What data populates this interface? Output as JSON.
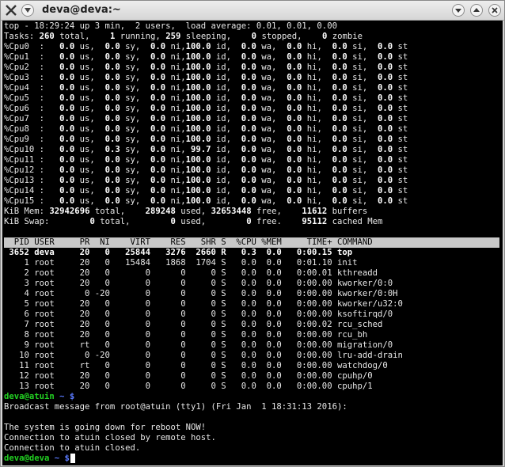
{
  "window": {
    "title": "deva@deva:~"
  },
  "top": {
    "summary": "top - 18:29:24 up 3 min,  2 users,  load average: 0.01, 0.01, 0.00",
    "tasks": {
      "label": "Tasks:",
      "total": "260",
      "total_l": "total,",
      "running": "1",
      "running_l": "running,",
      "sleeping": "259",
      "sleeping_l": "sleeping,",
      "stopped": "0",
      "stopped_l": "stopped,",
      "zombie": "0",
      "zombie_l": "zombie"
    },
    "cpu_rows": [
      {
        "label": "%Cpu0  :",
        "us": "0.0",
        "sy": "0.0",
        "ni": "0.0",
        "id": "100.0",
        "wa": "0.0",
        "hi": "0.0",
        "si": "0.0",
        "st": "0.0"
      },
      {
        "label": "%Cpu1  :",
        "us": "0.0",
        "sy": "0.0",
        "ni": "0.0",
        "id": "100.0",
        "wa": "0.0",
        "hi": "0.0",
        "si": "0.0",
        "st": "0.0"
      },
      {
        "label": "%Cpu2  :",
        "us": "0.0",
        "sy": "0.0",
        "ni": "0.0",
        "id": "100.0",
        "wa": "0.0",
        "hi": "0.0",
        "si": "0.0",
        "st": "0.0"
      },
      {
        "label": "%Cpu3  :",
        "us": "0.0",
        "sy": "0.0",
        "ni": "0.0",
        "id": "100.0",
        "wa": "0.0",
        "hi": "0.0",
        "si": "0.0",
        "st": "0.0"
      },
      {
        "label": "%Cpu4  :",
        "us": "0.0",
        "sy": "0.0",
        "ni": "0.0",
        "id": "100.0",
        "wa": "0.0",
        "hi": "0.0",
        "si": "0.0",
        "st": "0.0"
      },
      {
        "label": "%Cpu5  :",
        "us": "0.0",
        "sy": "0.0",
        "ni": "0.0",
        "id": "100.0",
        "wa": "0.0",
        "hi": "0.0",
        "si": "0.0",
        "st": "0.0"
      },
      {
        "label": "%Cpu6  :",
        "us": "0.0",
        "sy": "0.0",
        "ni": "0.0",
        "id": "100.0",
        "wa": "0.0",
        "hi": "0.0",
        "si": "0.0",
        "st": "0.0"
      },
      {
        "label": "%Cpu7  :",
        "us": "0.0",
        "sy": "0.0",
        "ni": "0.0",
        "id": "100.0",
        "wa": "0.0",
        "hi": "0.0",
        "si": "0.0",
        "st": "0.0"
      },
      {
        "label": "%Cpu8  :",
        "us": "0.0",
        "sy": "0.0",
        "ni": "0.0",
        "id": "100.0",
        "wa": "0.0",
        "hi": "0.0",
        "si": "0.0",
        "st": "0.0"
      },
      {
        "label": "%Cpu9  :",
        "us": "0.0",
        "sy": "0.0",
        "ni": "0.0",
        "id": "100.0",
        "wa": "0.0",
        "hi": "0.0",
        "si": "0.0",
        "st": "0.0"
      },
      {
        "label": "%Cpu10 :",
        "us": "0.0",
        "sy": "0.3",
        "ni": "0.0",
        "id": " 99.7",
        "wa": "0.0",
        "hi": "0.0",
        "si": "0.0",
        "st": "0.0"
      },
      {
        "label": "%Cpu11 :",
        "us": "0.0",
        "sy": "0.0",
        "ni": "0.0",
        "id": "100.0",
        "wa": "0.0",
        "hi": "0.0",
        "si": "0.0",
        "st": "0.0"
      },
      {
        "label": "%Cpu12 :",
        "us": "0.0",
        "sy": "0.0",
        "ni": "0.0",
        "id": "100.0",
        "wa": "0.0",
        "hi": "0.0",
        "si": "0.0",
        "st": "0.0"
      },
      {
        "label": "%Cpu13 :",
        "us": "0.0",
        "sy": "0.0",
        "ni": "0.0",
        "id": "100.0",
        "wa": "0.0",
        "hi": "0.0",
        "si": "0.0",
        "st": "0.0"
      },
      {
        "label": "%Cpu14 :",
        "us": "0.0",
        "sy": "0.0",
        "ni": "0.0",
        "id": "100.0",
        "wa": "0.0",
        "hi": "0.0",
        "si": "0.0",
        "st": "0.0"
      },
      {
        "label": "%Cpu15 :",
        "us": "0.0",
        "sy": "0.0",
        "ni": "0.0",
        "id": "100.0",
        "wa": "0.0",
        "hi": "0.0",
        "si": "0.0",
        "st": "0.0"
      }
    ],
    "mem": {
      "label": "KiB Mem:",
      "total": "32942696",
      "used": "289248",
      "free": "32653448",
      "buffers": "11612"
    },
    "swap": {
      "label": "KiB Swap:",
      "total": "0",
      "used": "0",
      "free": "0",
      "cached": "95112"
    },
    "columns": [
      "PID",
      "USER",
      "PR",
      "NI",
      "VIRT",
      "RES",
      "SHR",
      "S",
      "%CPU",
      "%MEM",
      "TIME+",
      "COMMAND"
    ],
    "processes": [
      {
        "pid": "3652",
        "user": "deva",
        "pr": "20",
        "ni": "0",
        "virt": "25844",
        "res": "3276",
        "shr": "2660",
        "s": "R",
        "cpu": "0.3",
        "mem": "0.0",
        "time": "0:00.15",
        "cmd": "top",
        "bold": true
      },
      {
        "pid": "1",
        "user": "root",
        "pr": "20",
        "ni": "0",
        "virt": "15484",
        "res": "1868",
        "shr": "1704",
        "s": "S",
        "cpu": "0.0",
        "mem": "0.0",
        "time": "0:01.10",
        "cmd": "init"
      },
      {
        "pid": "2",
        "user": "root",
        "pr": "20",
        "ni": "0",
        "virt": "0",
        "res": "0",
        "shr": "0",
        "s": "S",
        "cpu": "0.0",
        "mem": "0.0",
        "time": "0:00.01",
        "cmd": "kthreadd"
      },
      {
        "pid": "3",
        "user": "root",
        "pr": "20",
        "ni": "0",
        "virt": "0",
        "res": "0",
        "shr": "0",
        "s": "S",
        "cpu": "0.0",
        "mem": "0.0",
        "time": "0:00.00",
        "cmd": "kworker/0:0"
      },
      {
        "pid": "4",
        "user": "root",
        "pr": "0",
        "ni": "-20",
        "virt": "0",
        "res": "0",
        "shr": "0",
        "s": "S",
        "cpu": "0.0",
        "mem": "0.0",
        "time": "0:00.00",
        "cmd": "kworker/0:0H"
      },
      {
        "pid": "5",
        "user": "root",
        "pr": "20",
        "ni": "0",
        "virt": "0",
        "res": "0",
        "shr": "0",
        "s": "S",
        "cpu": "0.0",
        "mem": "0.0",
        "time": "0:00.00",
        "cmd": "kworker/u32:0"
      },
      {
        "pid": "6",
        "user": "root",
        "pr": "20",
        "ni": "0",
        "virt": "0",
        "res": "0",
        "shr": "0",
        "s": "S",
        "cpu": "0.0",
        "mem": "0.0",
        "time": "0:00.00",
        "cmd": "ksoftirqd/0"
      },
      {
        "pid": "7",
        "user": "root",
        "pr": "20",
        "ni": "0",
        "virt": "0",
        "res": "0",
        "shr": "0",
        "s": "S",
        "cpu": "0.0",
        "mem": "0.0",
        "time": "0:00.02",
        "cmd": "rcu_sched"
      },
      {
        "pid": "8",
        "user": "root",
        "pr": "20",
        "ni": "0",
        "virt": "0",
        "res": "0",
        "shr": "0",
        "s": "S",
        "cpu": "0.0",
        "mem": "0.0",
        "time": "0:00.00",
        "cmd": "rcu_bh"
      },
      {
        "pid": "9",
        "user": "root",
        "pr": "rt",
        "ni": "0",
        "virt": "0",
        "res": "0",
        "shr": "0",
        "s": "S",
        "cpu": "0.0",
        "mem": "0.0",
        "time": "0:00.00",
        "cmd": "migration/0"
      },
      {
        "pid": "10",
        "user": "root",
        "pr": "0",
        "ni": "-20",
        "virt": "0",
        "res": "0",
        "shr": "0",
        "s": "S",
        "cpu": "0.0",
        "mem": "0.0",
        "time": "0:00.00",
        "cmd": "lru-add-drain"
      },
      {
        "pid": "11",
        "user": "root",
        "pr": "rt",
        "ni": "0",
        "virt": "0",
        "res": "0",
        "shr": "0",
        "s": "S",
        "cpu": "0.0",
        "mem": "0.0",
        "time": "0:00.00",
        "cmd": "watchdog/0"
      },
      {
        "pid": "12",
        "user": "root",
        "pr": "20",
        "ni": "0",
        "virt": "0",
        "res": "0",
        "shr": "0",
        "s": "S",
        "cpu": "0.0",
        "mem": "0.0",
        "time": "0:00.00",
        "cmd": "cpuhp/0"
      },
      {
        "pid": "13",
        "user": "root",
        "pr": "20",
        "ni": "0",
        "virt": "0",
        "res": "0",
        "shr": "0",
        "s": "S",
        "cpu": "0.0",
        "mem": "0.0",
        "time": "0:00.00",
        "cmd": "cpuhp/1"
      }
    ]
  },
  "shell": {
    "prompt1_user": "deva@atuin",
    "prompt1_rest": " ~ $",
    "broadcast": "Broadcast message from root@atuin (tty1) (Fri Jan  1 18:31:13 2016):",
    "shutdown": "The system is going down for reboot NOW!",
    "closed1": "Connection to atuin closed by remote host.",
    "closed2": "Connection to atuin closed.",
    "prompt2_user": "deva@deva",
    "prompt2_rest": " ~ $"
  },
  "colors": {
    "prompt_user": "#22d022",
    "prompt_path": "#5a7aff",
    "terminal_bg": "#000000",
    "header_bg": "#c8c8c8"
  }
}
